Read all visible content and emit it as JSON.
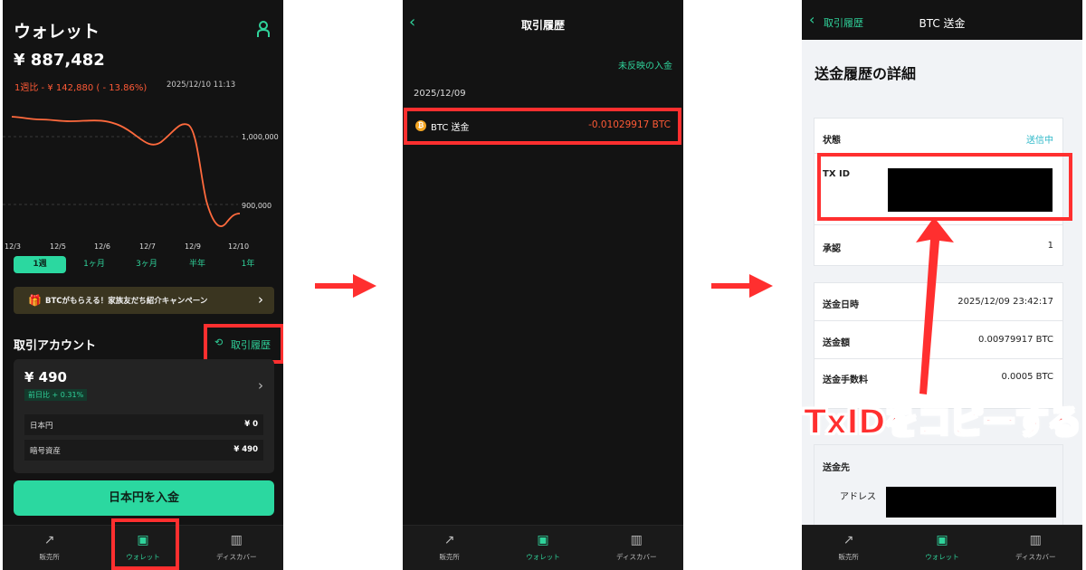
{
  "screen1": {
    "title": "ウォレット",
    "balance": "¥ 887,482",
    "change": "1週比 - ¥ 142,880 ( - 13.86%)",
    "change_time": "2025/12/10 11:13",
    "chart_labels": {
      "y_upper": "1,000,000",
      "y_lower": "900,000",
      "x": [
        "12/3",
        "12/5",
        "12/6",
        "12/7",
        "12/9",
        "12/10"
      ]
    },
    "period_tabs": [
      "1週",
      "1ヶ月",
      "3ヶ月",
      "半年",
      "1年"
    ],
    "campaign": "BTCがもらえる！家族友だち紹介キャンペーン",
    "account_title": "取引アカウント",
    "history_link": "取引履歴",
    "account_balance": "¥ 490",
    "account_change": "前日比 + 0.31%",
    "rows": [
      {
        "label": "日本円",
        "value": "¥ 0"
      },
      {
        "label": "暗号資産",
        "value": "¥ 490"
      }
    ],
    "deposit_button": "日本円を入金"
  },
  "screen2": {
    "title": "取引履歴",
    "unreflected": "未反映の入金",
    "date": "2025/12/09",
    "tx_label": "BTC 送金",
    "tx_amount": "-0.01029917 BTC"
  },
  "screen3": {
    "back_label": "取引履歴",
    "title": "BTC 送金",
    "heading": "送金履歴の詳細",
    "status_label": "状態",
    "status_value": "送信中",
    "txid_label": "TX ID",
    "confirm_label": "承認",
    "confirm_value": "1",
    "date_label": "送金日時",
    "date_value": "2025/12/09 23:42:17",
    "amount_label": "送金額",
    "amount_value": "0.00979917 BTC",
    "fee_label": "送金手数料",
    "fee_value": "0.0005 BTC",
    "dest_label": "送金先",
    "address_label": "アドレス"
  },
  "tabbar": [
    "販売所",
    "ウォレット",
    "ディスカバー"
  ],
  "callout": "TxIDをコピーする",
  "colors": {
    "accent": "#2bd8a0",
    "highlight": "#ff2f2f",
    "negative": "#ff5a36"
  }
}
